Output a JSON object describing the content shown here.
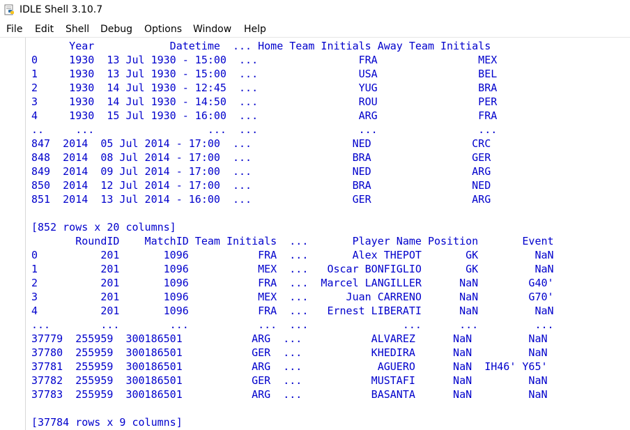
{
  "window": {
    "title": "IDLE Shell 3.10.7"
  },
  "icons": {
    "app": "python-idle-icon"
  },
  "colors": {
    "output_text": "#0000cc",
    "background": "#ffffff"
  },
  "menu": {
    "items": [
      {
        "label": "File"
      },
      {
        "label": "Edit"
      },
      {
        "label": "Shell"
      },
      {
        "label": "Debug"
      },
      {
        "label": "Options"
      },
      {
        "label": "Window"
      },
      {
        "label": "Help"
      }
    ]
  },
  "output": {
    "lines": [
      "      Year            Datetime  ... Home Team Initials Away Team Initials",
      "0     1930  13 Jul 1930 - 15:00  ...                FRA                MEX",
      "1     1930  13 Jul 1930 - 15:00  ...                USA                BEL",
      "2     1930  14 Jul 1930 - 12:45  ...                YUG                BRA",
      "3     1930  14 Jul 1930 - 14:50  ...                ROU                PER",
      "4     1930  15 Jul 1930 - 16:00  ...                ARG                FRA",
      "..     ...                  ...  ...                ...                ...",
      "847  2014  05 Jul 2014 - 17:00  ...                NED                CRC",
      "848  2014  08 Jul 2014 - 17:00  ...                BRA                GER",
      "849  2014  09 Jul 2014 - 17:00  ...                NED                ARG",
      "850  2014  12 Jul 2014 - 17:00  ...                BRA                NED",
      "851  2014  13 Jul 2014 - 16:00  ...                GER                ARG",
      "",
      "[852 rows x 20 columns]",
      "       RoundID    MatchID Team Initials  ...       Player Name Position       Event",
      "0          201       1096           FRA  ...       Alex THEPOT       GK         NaN",
      "1          201       1096           MEX  ...   Oscar BONFIGLIO       GK         NaN",
      "2          201       1096           FRA  ...  Marcel LANGILLER      NaN        G40'",
      "3          201       1096           MEX  ...      Juan CARRENO      NaN        G70'",
      "4          201       1096           FRA  ...   Ernest LIBERATI      NaN         NaN",
      "...        ...        ...           ...  ...               ...      ...         ...",
      "37779  255959  300186501           ARG  ...           ALVAREZ      NaN         NaN",
      "37780  255959  300186501           GER  ...           KHEDIRA      NaN         NaN",
      "37781  255959  300186501           ARG  ...            AGUERO      NaN  IH46' Y65'",
      "37782  255959  300186501           GER  ...           MUSTAFI      NaN         NaN",
      "37783  255959  300186501           ARG  ...           BASANTA      NaN         NaN",
      "",
      "[37784 rows x 9 columns]"
    ]
  }
}
